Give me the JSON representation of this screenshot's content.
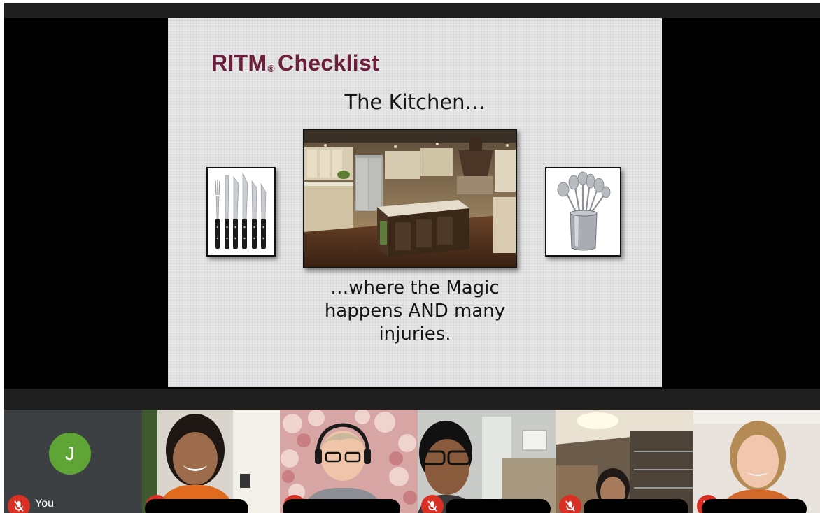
{
  "slide": {
    "title": "RITM",
    "title_mark": "®",
    "title_suffix": "Checklist",
    "subtitle": "The Kitchen…",
    "caption_lines": [
      "…where the Magic",
      "happens AND many",
      "injuries."
    ],
    "images": [
      "knives-image",
      "kitchen-photo",
      "utensils-image"
    ]
  },
  "participants": [
    {
      "label": "You",
      "initial": "J",
      "avatar_color": "#5fa536",
      "muted": true,
      "self": true
    },
    {
      "label": "",
      "muted": true
    },
    {
      "label": "",
      "muted": true
    },
    {
      "label": "",
      "muted": true
    },
    {
      "label": "",
      "muted": true
    },
    {
      "label": "",
      "muted": true
    }
  ],
  "colors": {
    "title": "#6e1f3c",
    "mute_badge": "#d93025",
    "self_tile": "#3c4043",
    "bars": "#1f1f1f"
  }
}
